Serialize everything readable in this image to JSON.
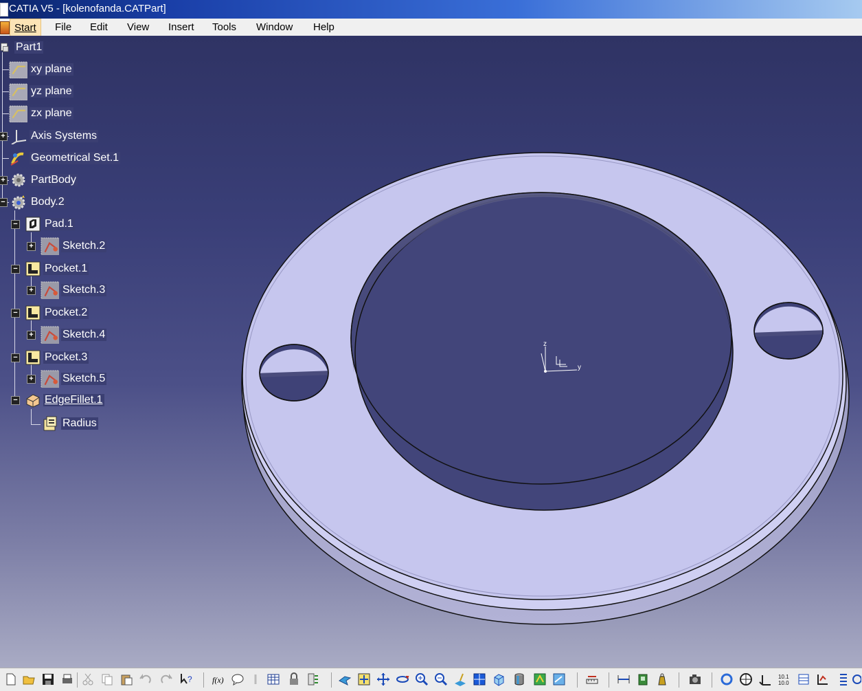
{
  "window": {
    "title": "CATIA V5 - [kolenofanda.CATPart]"
  },
  "menu": {
    "start": "Start",
    "file": "File",
    "edit": "Edit",
    "view": "View",
    "insert": "Insert",
    "tools": "Tools",
    "window": "Window",
    "help": "Help"
  },
  "tree": {
    "root": "Part1",
    "xy_plane": "xy plane",
    "yz_plane": "yz plane",
    "zx_plane": "zx plane",
    "axis_systems": "Axis Systems",
    "geometrical_set": "Geometrical Set.1",
    "partbody": "PartBody",
    "body2": "Body.2",
    "pad1": "Pad.1",
    "sketch2": "Sketch.2",
    "pocket1": "Pocket.1",
    "sketch3": "Sketch.3",
    "pocket2": "Pocket.2",
    "sketch4": "Sketch.4",
    "pocket3": "Pocket.3",
    "sketch5": "Sketch.5",
    "edgefillet1": "EdgeFillet.1",
    "radius": "Radius"
  },
  "compass": {
    "z": "z",
    "y": "y"
  },
  "colors": {
    "viewport_top": "#2f3364",
    "viewport_bottom": "#a9abc4",
    "part_face": "#c6c6ee",
    "tree_label_bg": "#3b3f72"
  },
  "toolbar_icons": [
    "new-icon",
    "open-icon",
    "save-icon",
    "print-icon",
    "cut-icon",
    "copy-icon",
    "paste-icon",
    "undo-icon",
    "redo-icon",
    "whats-this-icon",
    "formula-icon",
    "comment-icon",
    "tools-icon",
    "table-icon",
    "lock-icon",
    "layers-icon",
    "fly-mode-icon",
    "fit-all-icon",
    "pan-icon",
    "rotate-icon",
    "zoom-in-icon",
    "zoom-out-icon",
    "normal-view-icon",
    "multi-view-icon",
    "iso-view-icon",
    "shading-icon",
    "hide-show-icon",
    "swap-space-icon",
    "measure-icon",
    "measure-between-icon",
    "catalog-icon",
    "mass-icon",
    "camera-icon",
    "refresh-icon",
    "compass-icon",
    "dimension-icon",
    "grid-icon",
    "publish-icon",
    "spec-icon"
  ]
}
